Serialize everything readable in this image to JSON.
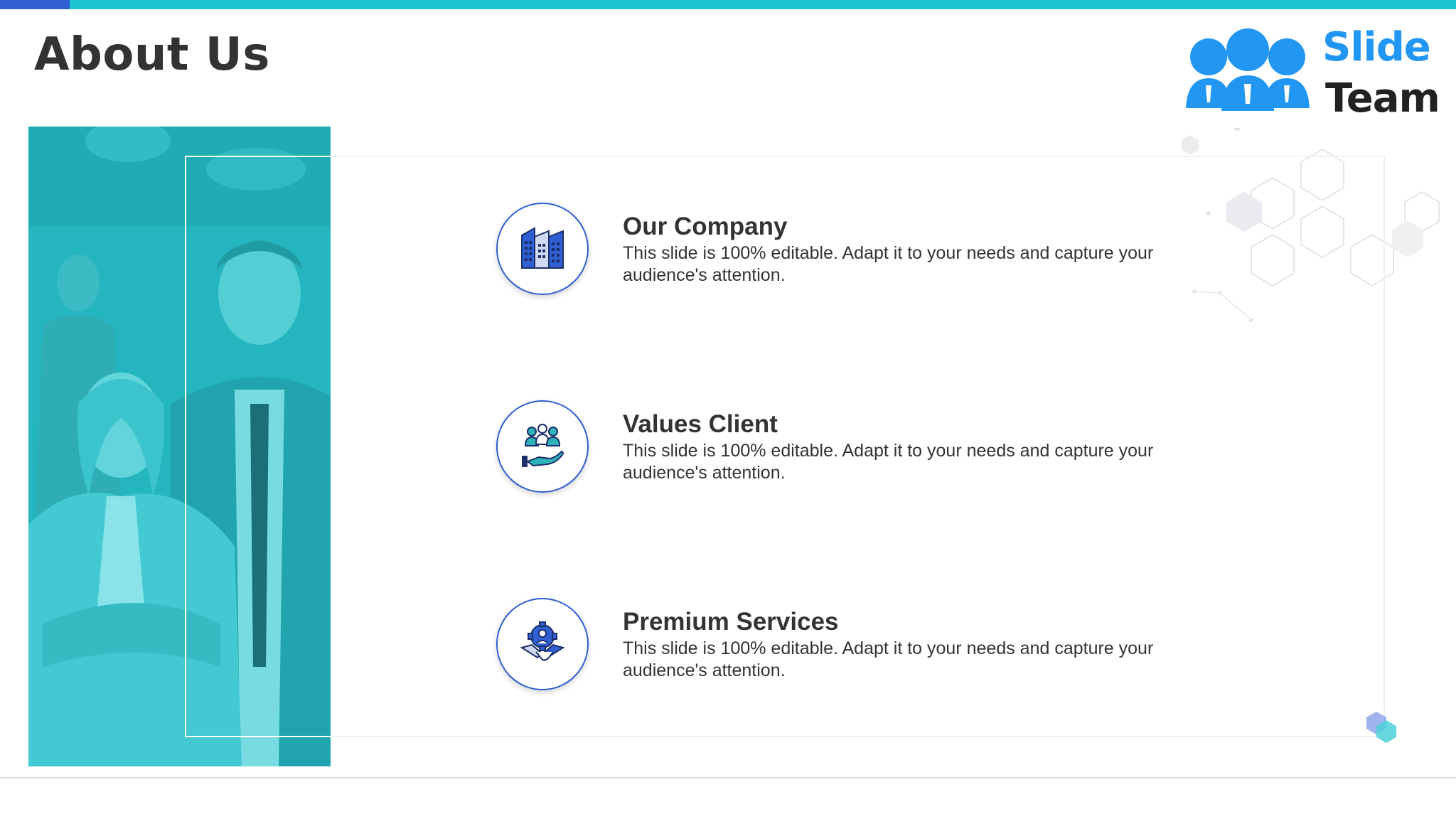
{
  "slide": {
    "title": "About Us"
  },
  "logo": {
    "line1": "Slide",
    "line2": "Team"
  },
  "items": [
    {
      "title": "Our Company",
      "description": "This slide is 100% editable. Adapt it to your needs and capture your audience's attention.",
      "icon": "buildings-icon"
    },
    {
      "title": "Values Client",
      "description": "This slide is 100% editable. Adapt it to your needs and capture your audience's attention.",
      "icon": "hand-people-icon"
    },
    {
      "title": "Premium Services",
      "description": "This slide is 100% editable. Adapt it to your needs and capture your audience's attention.",
      "icon": "gear-handshake-icon"
    }
  ],
  "colors": {
    "accent_teal": "#1bc3d3",
    "accent_blue": "#2f5fd0",
    "logo_blue": "#2196f3",
    "text_dark": "#333333"
  }
}
